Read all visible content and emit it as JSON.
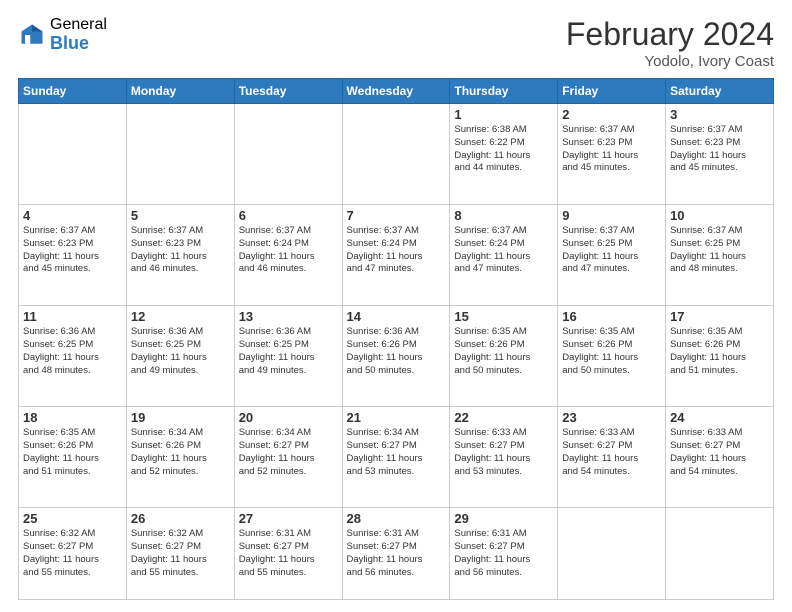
{
  "logo": {
    "general": "General",
    "blue": "Blue"
  },
  "title": "February 2024",
  "subtitle": "Yodolo, Ivory Coast",
  "days_of_week": [
    "Sunday",
    "Monday",
    "Tuesday",
    "Wednesday",
    "Thursday",
    "Friday",
    "Saturday"
  ],
  "weeks": [
    [
      {
        "day": "",
        "info": ""
      },
      {
        "day": "",
        "info": ""
      },
      {
        "day": "",
        "info": ""
      },
      {
        "day": "",
        "info": ""
      },
      {
        "day": "1",
        "info": "Sunrise: 6:38 AM\nSunset: 6:22 PM\nDaylight: 11 hours\nand 44 minutes."
      },
      {
        "day": "2",
        "info": "Sunrise: 6:37 AM\nSunset: 6:23 PM\nDaylight: 11 hours\nand 45 minutes."
      },
      {
        "day": "3",
        "info": "Sunrise: 6:37 AM\nSunset: 6:23 PM\nDaylight: 11 hours\nand 45 minutes."
      }
    ],
    [
      {
        "day": "4",
        "info": "Sunrise: 6:37 AM\nSunset: 6:23 PM\nDaylight: 11 hours\nand 45 minutes."
      },
      {
        "day": "5",
        "info": "Sunrise: 6:37 AM\nSunset: 6:23 PM\nDaylight: 11 hours\nand 46 minutes."
      },
      {
        "day": "6",
        "info": "Sunrise: 6:37 AM\nSunset: 6:24 PM\nDaylight: 11 hours\nand 46 minutes."
      },
      {
        "day": "7",
        "info": "Sunrise: 6:37 AM\nSunset: 6:24 PM\nDaylight: 11 hours\nand 47 minutes."
      },
      {
        "day": "8",
        "info": "Sunrise: 6:37 AM\nSunset: 6:24 PM\nDaylight: 11 hours\nand 47 minutes."
      },
      {
        "day": "9",
        "info": "Sunrise: 6:37 AM\nSunset: 6:25 PM\nDaylight: 11 hours\nand 47 minutes."
      },
      {
        "day": "10",
        "info": "Sunrise: 6:37 AM\nSunset: 6:25 PM\nDaylight: 11 hours\nand 48 minutes."
      }
    ],
    [
      {
        "day": "11",
        "info": "Sunrise: 6:36 AM\nSunset: 6:25 PM\nDaylight: 11 hours\nand 48 minutes."
      },
      {
        "day": "12",
        "info": "Sunrise: 6:36 AM\nSunset: 6:25 PM\nDaylight: 11 hours\nand 49 minutes."
      },
      {
        "day": "13",
        "info": "Sunrise: 6:36 AM\nSunset: 6:25 PM\nDaylight: 11 hours\nand 49 minutes."
      },
      {
        "day": "14",
        "info": "Sunrise: 6:36 AM\nSunset: 6:26 PM\nDaylight: 11 hours\nand 50 minutes."
      },
      {
        "day": "15",
        "info": "Sunrise: 6:35 AM\nSunset: 6:26 PM\nDaylight: 11 hours\nand 50 minutes."
      },
      {
        "day": "16",
        "info": "Sunrise: 6:35 AM\nSunset: 6:26 PM\nDaylight: 11 hours\nand 50 minutes."
      },
      {
        "day": "17",
        "info": "Sunrise: 6:35 AM\nSunset: 6:26 PM\nDaylight: 11 hours\nand 51 minutes."
      }
    ],
    [
      {
        "day": "18",
        "info": "Sunrise: 6:35 AM\nSunset: 6:26 PM\nDaylight: 11 hours\nand 51 minutes."
      },
      {
        "day": "19",
        "info": "Sunrise: 6:34 AM\nSunset: 6:26 PM\nDaylight: 11 hours\nand 52 minutes."
      },
      {
        "day": "20",
        "info": "Sunrise: 6:34 AM\nSunset: 6:27 PM\nDaylight: 11 hours\nand 52 minutes."
      },
      {
        "day": "21",
        "info": "Sunrise: 6:34 AM\nSunset: 6:27 PM\nDaylight: 11 hours\nand 53 minutes."
      },
      {
        "day": "22",
        "info": "Sunrise: 6:33 AM\nSunset: 6:27 PM\nDaylight: 11 hours\nand 53 minutes."
      },
      {
        "day": "23",
        "info": "Sunrise: 6:33 AM\nSunset: 6:27 PM\nDaylight: 11 hours\nand 54 minutes."
      },
      {
        "day": "24",
        "info": "Sunrise: 6:33 AM\nSunset: 6:27 PM\nDaylight: 11 hours\nand 54 minutes."
      }
    ],
    [
      {
        "day": "25",
        "info": "Sunrise: 6:32 AM\nSunset: 6:27 PM\nDaylight: 11 hours\nand 55 minutes."
      },
      {
        "day": "26",
        "info": "Sunrise: 6:32 AM\nSunset: 6:27 PM\nDaylight: 11 hours\nand 55 minutes."
      },
      {
        "day": "27",
        "info": "Sunrise: 6:31 AM\nSunset: 6:27 PM\nDaylight: 11 hours\nand 55 minutes."
      },
      {
        "day": "28",
        "info": "Sunrise: 6:31 AM\nSunset: 6:27 PM\nDaylight: 11 hours\nand 56 minutes."
      },
      {
        "day": "29",
        "info": "Sunrise: 6:31 AM\nSunset: 6:27 PM\nDaylight: 11 hours\nand 56 minutes."
      },
      {
        "day": "",
        "info": ""
      },
      {
        "day": "",
        "info": ""
      }
    ]
  ]
}
